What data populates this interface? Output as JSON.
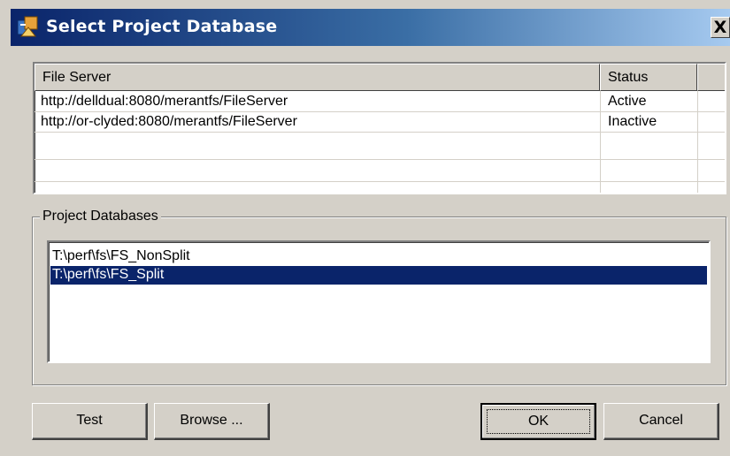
{
  "window": {
    "title": "Select Project Database",
    "close_label": "X",
    "icon": "app-database-icon"
  },
  "file_servers": {
    "columns": [
      "File Server",
      "Status"
    ],
    "rows": [
      {
        "server": "http://delldual:8080/merantfs/FileServer",
        "status": "Active"
      },
      {
        "server": "http://or-clyded:8080/merantfs/FileServer",
        "status": "Inactive"
      }
    ]
  },
  "project_databases": {
    "label": "Project Databases",
    "items": [
      {
        "path": "T:\\perf\\fs\\FS_NonSplit",
        "selected": false
      },
      {
        "path": "T:\\perf\\fs\\FS_Split",
        "selected": true
      }
    ]
  },
  "buttons": {
    "test": "Test",
    "browse": "Browse ...",
    "ok": "OK",
    "cancel": "Cancel"
  },
  "colors": {
    "selection": "#0a246a",
    "face": "#d4d0c8"
  }
}
